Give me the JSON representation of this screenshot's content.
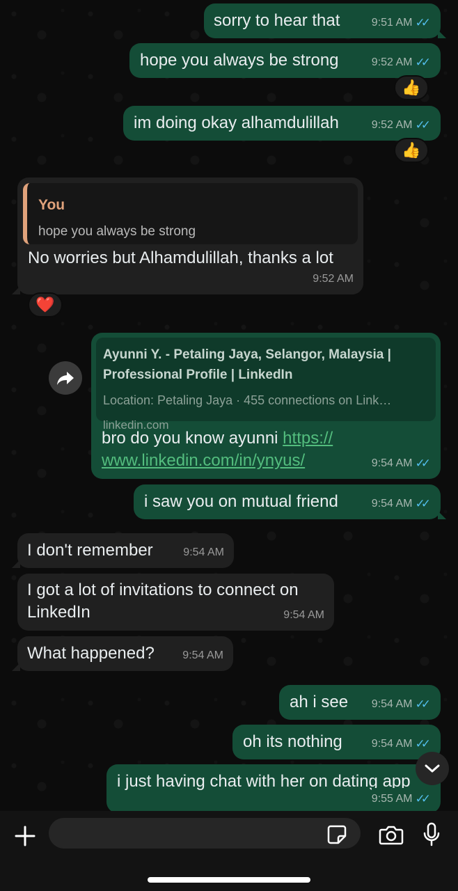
{
  "messages": [
    {
      "text": "sorry to hear that",
      "time": "9:51 AM"
    },
    {
      "text": "hope you always be strong",
      "time": "9:52 AM",
      "reaction": "👍"
    },
    {
      "text": "im doing okay alhamdulillah",
      "time": "9:52 AM",
      "reaction": "👍"
    },
    {
      "quote_author": "You",
      "quote_text": "hope you always be strong",
      "text": "No worries but Alhamdulillah, thanks a lot",
      "time": "9:52 AM",
      "reaction": "❤️"
    },
    {
      "link_title_line1": "Ayunni Y. - Petaling Jaya, Selangor, Malaysia |",
      "link_title_line2": "Professional Profile | LinkedIn",
      "link_desc": "Location: Petaling Jaya · 455 connections on Link…",
      "link_domain": "linkedin.com",
      "text": "bro do you know ayunni ",
      "url_line1": "https://",
      "url_line2": "www.linkedin.com/in/ynyus/",
      "time": "9:54 AM"
    },
    {
      "text": "i saw you on mutual friend",
      "time": "9:54 AM"
    },
    {
      "text": "I don't remember",
      "time": "9:54 AM"
    },
    {
      "text_line1": "I got a lot of invitations to connect on",
      "text_line2": "LinkedIn",
      "time": "9:54 AM"
    },
    {
      "text": "What happened?",
      "time": "9:54 AM"
    },
    {
      "text": "ah i see",
      "time": "9:54 AM"
    },
    {
      "text": "oh its nothing",
      "time": "9:54 AM"
    },
    {
      "text": "i just having chat with her on dating app",
      "time": "9:55 AM"
    }
  ],
  "composer": {
    "placeholder": ""
  },
  "icons": {
    "read_receipt": "double-check-icon",
    "forward": "forward-icon",
    "scroll": "chevron-down-icon",
    "attach": "plus-icon",
    "sticker": "sticker-icon",
    "camera": "camera-icon",
    "mic": "microphone-icon"
  },
  "colors": {
    "outgoing_bubble": "#144d37",
    "incoming_bubble": "#202020",
    "read_ticks": "#53bdeb",
    "link": "#53bd7e",
    "quote_accent": "#e0a27b"
  }
}
